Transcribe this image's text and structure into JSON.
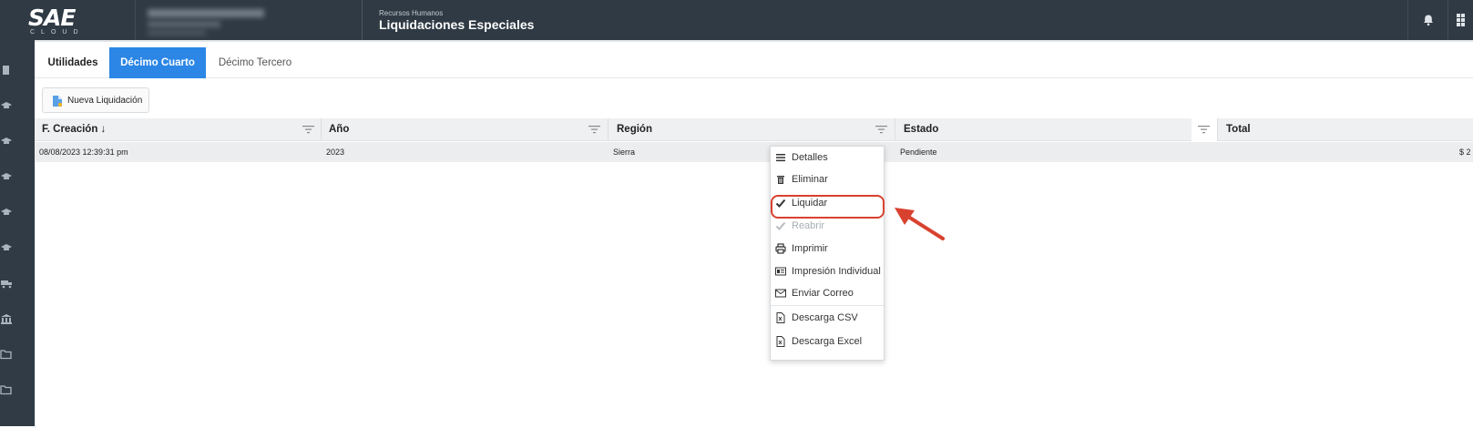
{
  "header": {
    "logo_text": "SAE",
    "logo_sub": "CLOUD",
    "module": "Recursos Humanos",
    "title": "Liquidaciones Especiales"
  },
  "tabs": [
    {
      "label": "Utilidades",
      "active": false
    },
    {
      "label": "Décimo Cuarto",
      "active": true
    },
    {
      "label": "Décimo Tercero",
      "active": false
    }
  ],
  "toolbar": {
    "new_label": "Nueva Liquidación"
  },
  "table": {
    "columns": [
      "F. Creación ↓",
      "Año",
      "Región",
      "Estado",
      "Total"
    ],
    "rows": [
      {
        "fecha": "08/08/2023 12:39:31 pm",
        "anio": "2023",
        "region": "Sierra",
        "estado": "Pendiente",
        "total": "$ 2"
      }
    ]
  },
  "context_menu": {
    "items": [
      {
        "label": "Detalles",
        "icon": "list-icon",
        "disabled": false
      },
      {
        "label": "Eliminar",
        "icon": "trash-icon",
        "disabled": false
      },
      {
        "label": "Liquidar",
        "icon": "check-icon",
        "disabled": false,
        "highlighted": true
      },
      {
        "label": "Reabrir",
        "icon": "check-icon",
        "disabled": true
      },
      {
        "label": "Imprimir",
        "icon": "printer-icon",
        "disabled": false
      },
      {
        "label": "Impresión Individual",
        "icon": "id-card-icon",
        "disabled": false
      },
      {
        "label": "Enviar Correo",
        "icon": "envelope-icon",
        "disabled": false
      },
      {
        "label": "Descarga CSV",
        "icon": "file-csv-icon",
        "disabled": false
      },
      {
        "label": "Descarga Excel",
        "icon": "file-excel-icon",
        "disabled": false
      }
    ]
  },
  "colors": {
    "topbar": "#2f3a44",
    "active_tab": "#2b86e6",
    "highlight": "#d9412f"
  }
}
